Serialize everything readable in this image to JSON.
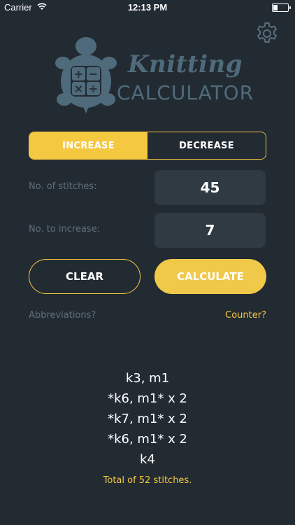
{
  "status_bar": {
    "carrier": "Carrier",
    "time": "12:13 PM"
  },
  "logo": {
    "title_line1": "Knitting",
    "title_line2": "CALCULATOR",
    "icon_symbols": [
      "+",
      "−",
      "×",
      "÷"
    ]
  },
  "mode_toggle": {
    "increase_label": "INCREASE",
    "decrease_label": "DECREASE",
    "selected": "INCREASE"
  },
  "fields": {
    "stitches_label": "No. of stitches:",
    "stitches_value": "45",
    "increase_label": "No. to increase:",
    "increase_value": "7"
  },
  "actions": {
    "clear_label": "CLEAR",
    "calculate_label": "CALCULATE"
  },
  "links": {
    "abbreviations": "Abbreviations?",
    "counter": "Counter?"
  },
  "results": {
    "lines": [
      "k3, m1",
      "*k6, m1* x 2",
      "*k7, m1* x 2",
      "*k6, m1* x 2",
      "k4"
    ],
    "total": "Total of 52 stitches."
  },
  "colors": {
    "background": "#232b32",
    "accent": "#f5c842",
    "muted_text": "#5d6f7b",
    "field_bg": "#2f3a43",
    "logo": "#4f6b7b"
  },
  "icons": {
    "settings": "gear-icon",
    "wifi": "wifi-icon",
    "battery": "battery-icon",
    "logo": "turtle-calculator-icon"
  }
}
